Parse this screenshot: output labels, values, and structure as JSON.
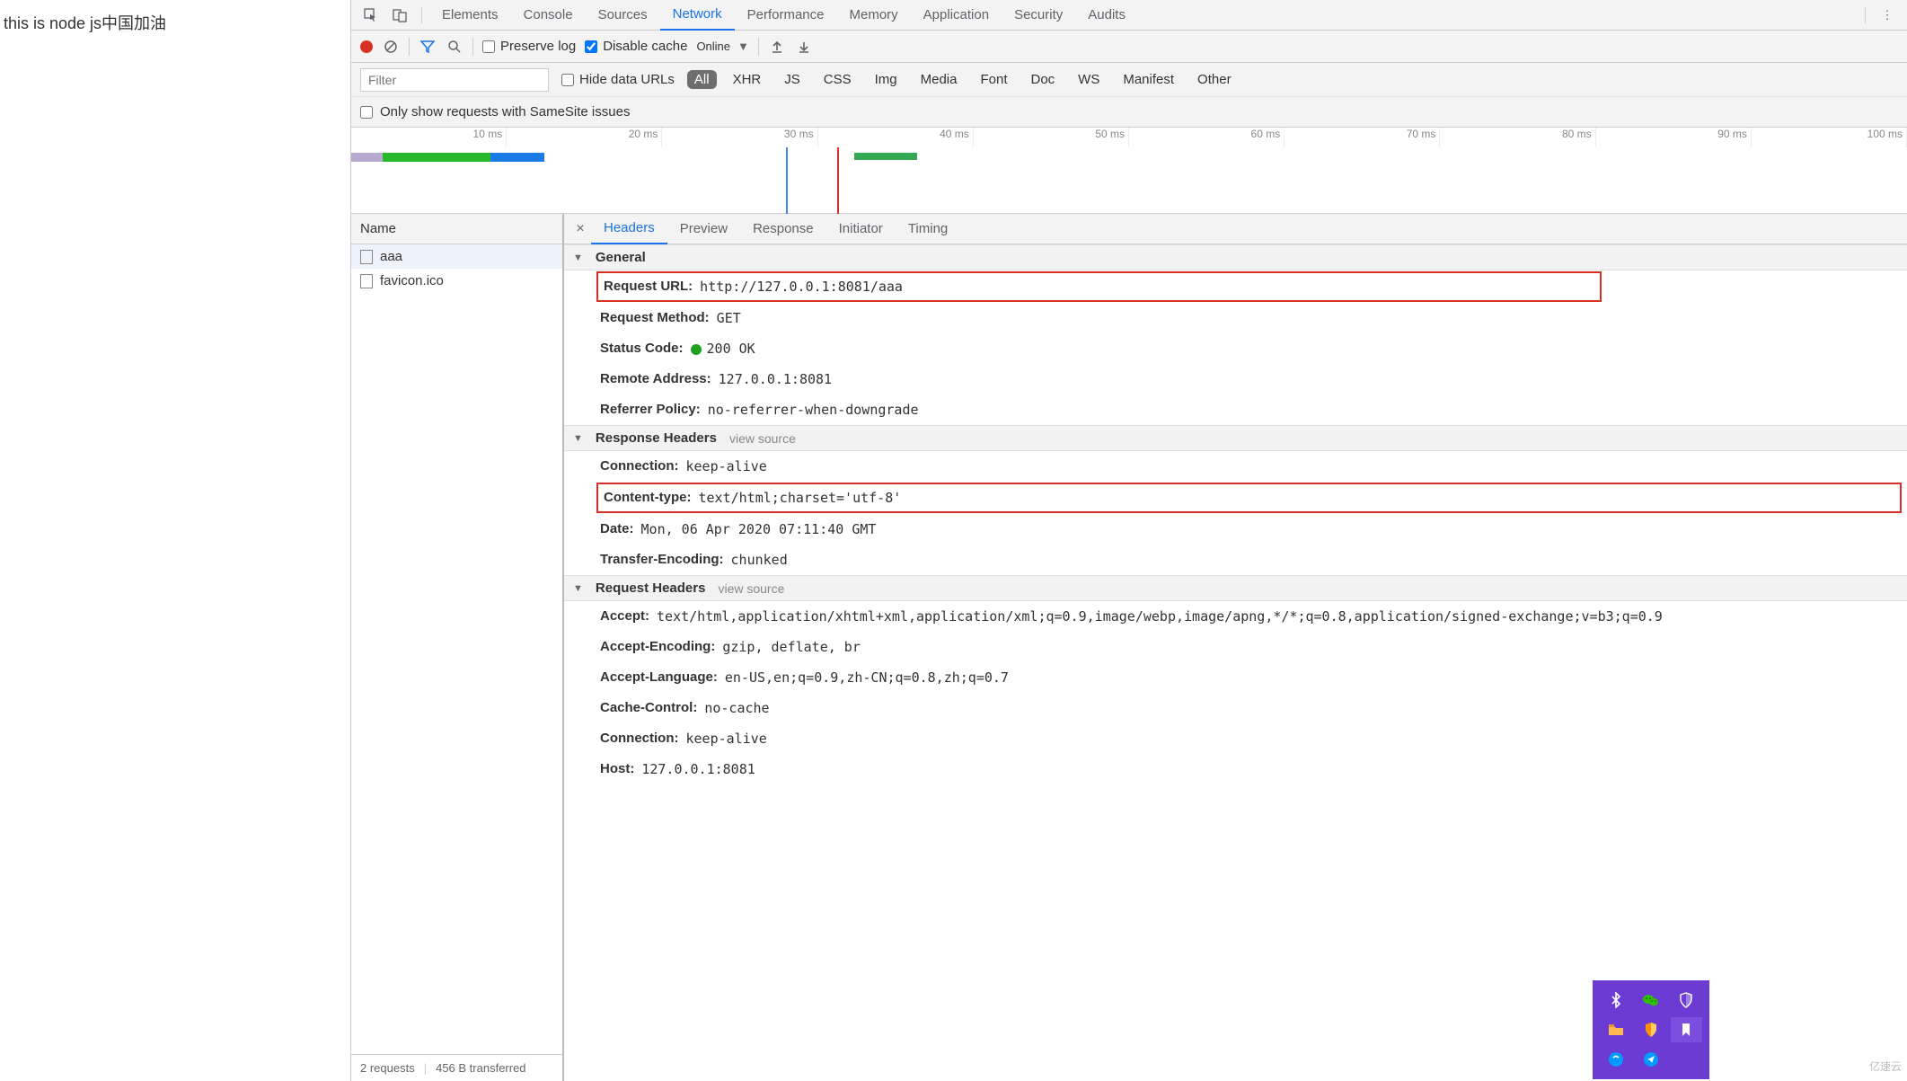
{
  "page": {
    "content": "this is node js中国加油"
  },
  "tabs": [
    "Elements",
    "Console",
    "Sources",
    "Network",
    "Performance",
    "Memory",
    "Application",
    "Security",
    "Audits"
  ],
  "tabs_active": "Network",
  "toolbar": {
    "preserve_log": "Preserve log",
    "disable_cache": "Disable cache",
    "throttle": "Online"
  },
  "filterbar": {
    "placeholder": "Filter",
    "hide_data_urls": "Hide data URLs",
    "chips": [
      "All",
      "XHR",
      "JS",
      "CSS",
      "Img",
      "Media",
      "Font",
      "Doc",
      "WS",
      "Manifest",
      "Other"
    ],
    "chip_active": "All"
  },
  "samesite": "Only show requests with SameSite issues",
  "timeline_ticks": [
    "10 ms",
    "20 ms",
    "30 ms",
    "40 ms",
    "50 ms",
    "60 ms",
    "70 ms",
    "80 ms",
    "90 ms",
    "100 ms"
  ],
  "reqlist": {
    "header": "Name",
    "rows": [
      "aaa",
      "favicon.ico"
    ],
    "footer": {
      "count": "2 requests",
      "size": "456 B transferred"
    }
  },
  "detail_tabs": [
    "Headers",
    "Preview",
    "Response",
    "Initiator",
    "Timing"
  ],
  "detail_tab_active": "Headers",
  "sections": {
    "general": {
      "title": "General",
      "items": [
        {
          "k": "Request URL:",
          "v": "http://127.0.0.1:8081/aaa",
          "boxed": true,
          "wide": true
        },
        {
          "k": "Request Method:",
          "v": "GET"
        },
        {
          "k": "Status Code:",
          "v": "200 OK",
          "status": true
        },
        {
          "k": "Remote Address:",
          "v": "127.0.0.1:8081"
        },
        {
          "k": "Referrer Policy:",
          "v": "no-referrer-when-downgrade"
        }
      ]
    },
    "response": {
      "title": "Response Headers",
      "viewsrc": "view source",
      "items": [
        {
          "k": "Connection:",
          "v": "keep-alive"
        },
        {
          "k": "Content-type:",
          "v": "text/html;charset='utf-8'",
          "boxed": true
        },
        {
          "k": "Date:",
          "v": "Mon, 06 Apr 2020 07:11:40 GMT"
        },
        {
          "k": "Transfer-Encoding:",
          "v": "chunked"
        }
      ]
    },
    "request": {
      "title": "Request Headers",
      "viewsrc": "view source",
      "items": [
        {
          "k": "Accept:",
          "v": "text/html,application/xhtml+xml,application/xml;q=0.9,image/webp,image/apng,*/*;q=0.8,application/signed-exchange;v=b3;q=0.9"
        },
        {
          "k": "Accept-Encoding:",
          "v": "gzip, deflate, br"
        },
        {
          "k": "Accept-Language:",
          "v": "en-US,en;q=0.9,zh-CN;q=0.8,zh;q=0.7"
        },
        {
          "k": "Cache-Control:",
          "v": "no-cache"
        },
        {
          "k": "Connection:",
          "v": "keep-alive"
        },
        {
          "k": "Host:",
          "v": "127.0.0.1:8081"
        }
      ]
    }
  }
}
